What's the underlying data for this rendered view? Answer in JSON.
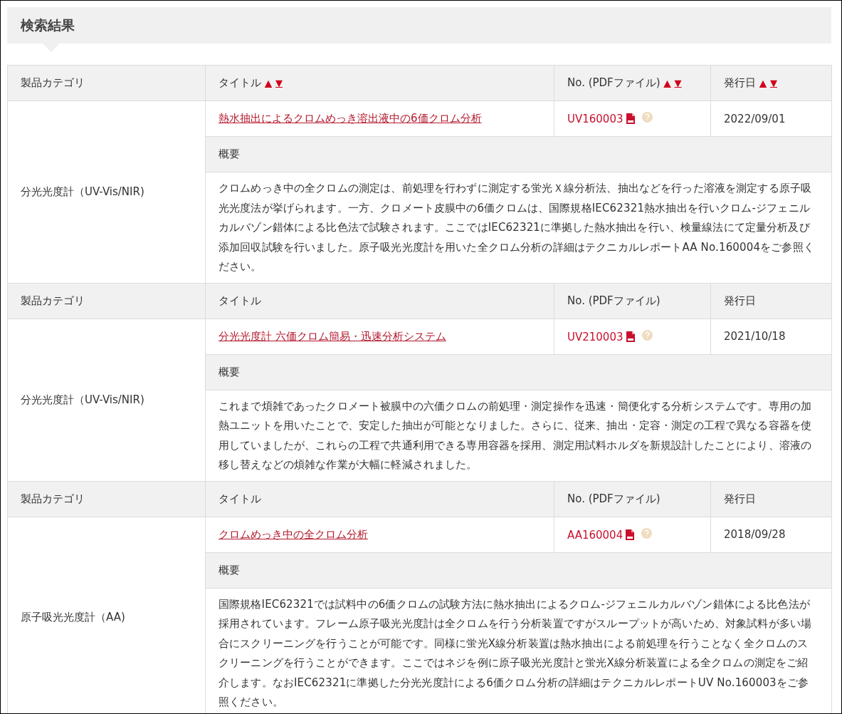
{
  "heading": "検索結果",
  "records": [
    {
      "headers": [
        {
          "label": "製品カテゴリ"
        },
        {
          "label": "タイトル",
          "sort": [
            "▲",
            "▼"
          ]
        },
        {
          "label": "No. (PDFファイル)",
          "sort": [
            "▲",
            "▼"
          ]
        },
        {
          "label": "発行日",
          "sort": [
            "▲",
            "▼"
          ]
        }
      ],
      "category": "分光光度計（UV-Vis/NIR)",
      "title": "熱水抽出によるクロムめっき溶出液中の6価クロム分析",
      "number": "UV160003",
      "date": "2022/09/01",
      "summary_label": "概要",
      "summary": "クロムめっき中の全クロムの測定は、前処理を行わずに測定する蛍光Ｘ線分析法、抽出などを行った溶液を測定する原子吸光光度法が挙げられます。一方、クロメート皮膜中の6価クロムは、国際規格IEC62321熱水抽出を行いクロム-ジフェニルカルバゾン錯体による比色法で試験されます。ここではIEC62321に準拠した熱水抽出を行い、検量線法にて定量分析及び添加回収試験を行いました。原子吸光光度計を用いた全クロム分析の詳細はテクニカルレポートAA No.160004をご参照ください。"
    },
    {
      "headers": [
        {
          "label": "製品カテゴリ"
        },
        {
          "label": "タイトル"
        },
        {
          "label": "No. (PDFファイル)"
        },
        {
          "label": "発行日"
        }
      ],
      "category": "分光光度計（UV-Vis/NIR)",
      "title": "分光光度計 六価クロム簡易・迅速分析システム",
      "number": "UV210003",
      "date": "2021/10/18",
      "summary_label": "概要",
      "summary": "これまで煩雑であったクロメート被膜中の六価クロムの前処理・測定操作を迅速・簡便化する分析システムです。専用の加熱ユニットを用いたことで、安定した抽出が可能となりました。さらに、従来、抽出・定容・測定の工程で異なる容器を使用していましたが、これらの工程で共通利用できる専用容器を採用、測定用試料ホルダを新規設計したことにより、溶液の移し替えなどの煩雑な作業が大幅に軽減されました。"
    },
    {
      "headers": [
        {
          "label": "製品カテゴリ"
        },
        {
          "label": "タイトル"
        },
        {
          "label": "No. (PDFファイル)"
        },
        {
          "label": "発行日"
        }
      ],
      "category": "原子吸光光度計（AA)",
      "title": "クロムめっき中の全クロム分析",
      "number": "AA160004",
      "date": "2018/09/28",
      "summary_label": "概要",
      "summary": "国際規格IEC62321では試料中の6価クロムの試験方法に熱水抽出によるクロム-ジフェニルカルバゾン錯体による比色法が採用されています。フレーム原子吸光光度計は全クロムを行う分析装置ですがスループットが高いため、対象試料が多い場合にスクリーニングを行うことが可能です。同様に蛍光X線分析装置は熱水抽出による前処理を行うことなく全クロムのスクリーニングを行うことができます。ここではネジを例に原子吸光光度計と蛍光X線分析装置による全クロムの測定をご紹介します。なおIEC62321に準拠した分光光度計による6価クロム分析の詳細はテクニカルレポートUV No.160003をご参照ください。"
    }
  ]
}
